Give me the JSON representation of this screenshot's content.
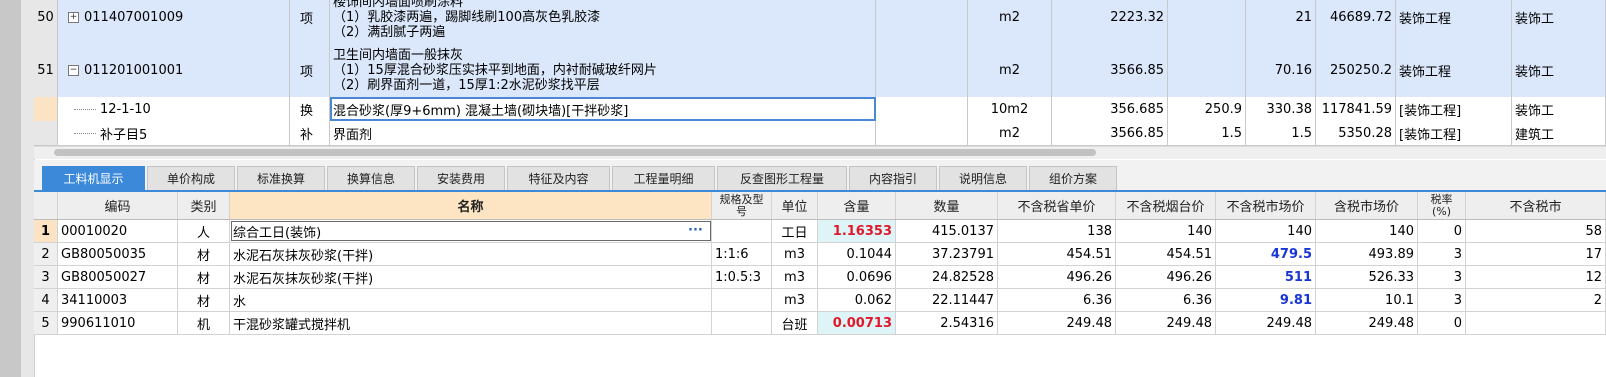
{
  "upper_rows": [
    {
      "num": "50",
      "code": "011407001009",
      "kind": "项",
      "desc": [
        "楼饰间内墙面喷刷涂料",
        "（1）乳胶漆两遍，踢脚线刷100高灰色乳胶漆",
        "（2）满刮腻子两遍"
      ],
      "unit": "m2",
      "qty": "2223.32",
      "price": "",
      "unitprice": "21",
      "total": "46689.72",
      "prof": "装饰工程",
      "prof2": "装饰工"
    },
    {
      "num": "51",
      "code": "011201001001",
      "kind": "项",
      "desc": [
        "卫生间内墙面一般抹灰",
        "（1）15厚混合砂浆压实抹平到地面，内衬耐碱玻纤网片",
        "（2）刷界面剂一道，15厚1:2水泥砂浆找平层"
      ],
      "unit": "m2",
      "qty": "3566.85",
      "price": "",
      "unitprice": "70.16",
      "total": "250250.2",
      "prof": "装饰工程",
      "prof2": "装饰工"
    },
    {
      "num": "",
      "code": "12-1-10",
      "kind": "换",
      "desc": [
        "混合砂浆(厚9+6mm) 混凝土墙(砌块墙)[干拌砂浆]"
      ],
      "unit": "10m2",
      "qty": "356.685",
      "price": "250.9",
      "unitprice": "330.38",
      "total": "117841.59",
      "prof": "[装饰工程]",
      "prof2": "装饰工"
    },
    {
      "num": "",
      "code": "补子目5",
      "kind": "补",
      "desc": [
        "界面剂"
      ],
      "unit": "m2",
      "qty": "3566.85",
      "price": "1.5",
      "unitprice": "1.5",
      "total": "5350.28",
      "prof": "[装饰工程]",
      "prof2": "建筑工"
    }
  ],
  "tabs": [
    "工料机显示",
    "单价构成",
    "标准换算",
    "换算信息",
    "安装费用",
    "特征及内容",
    "工程量明细",
    "反查图形工程量",
    "内容指引",
    "说明信息",
    "组价方案"
  ],
  "headers": {
    "code": "编码",
    "type": "类别",
    "name": "名称",
    "spec": "规格及型号",
    "unit": "单位",
    "content": "含量",
    "qty": "数量",
    "p1": "不含税省单价",
    "p2": "不含税烟台价",
    "p3": "不含税市场价",
    "p4": "含税市场价",
    "tax": "税率(%)",
    "p5": "不含税市"
  },
  "rows": [
    {
      "rn": "1",
      "code": "00010020",
      "type": "人",
      "name": "综合工日(装饰)",
      "spec": "",
      "unit": "工日",
      "content": "1.16353",
      "qty": "415.0137",
      "p1": "138",
      "p2": "140",
      "p3": "140",
      "p4": "140",
      "tax": "0",
      "p5": "58"
    },
    {
      "rn": "2",
      "code": "GB80050035",
      "type": "材",
      "name": "水泥石灰抹灰砂浆(干拌)",
      "spec": "1:1:6",
      "unit": "m3",
      "content": "0.1044",
      "qty": "37.23791",
      "p1": "454.51",
      "p2": "454.51",
      "p3": "479.5",
      "p4": "493.89",
      "tax": "3",
      "p5": "17"
    },
    {
      "rn": "3",
      "code": "GB80050027",
      "type": "材",
      "name": "水泥石灰抹灰砂浆(干拌)",
      "spec": "1:0.5:3",
      "unit": "m3",
      "content": "0.0696",
      "qty": "24.82528",
      "p1": "496.26",
      "p2": "496.26",
      "p3": "511",
      "p4": "526.33",
      "tax": "3",
      "p5": "12"
    },
    {
      "rn": "4",
      "code": "34110003",
      "type": "材",
      "name": "水",
      "spec": "",
      "unit": "m3",
      "content": "0.062",
      "qty": "22.11447",
      "p1": "6.36",
      "p2": "6.36",
      "p3": "9.81",
      "p4": "10.1",
      "tax": "3",
      "p5": "2"
    },
    {
      "rn": "5",
      "code": "990611010",
      "type": "机",
      "name": "干混砂浆罐式搅拌机",
      "spec": "",
      "unit": "台班",
      "content": "0.00713",
      "qty": "2.54316",
      "p1": "249.48",
      "p2": "249.48",
      "p3": "249.48",
      "p4": "249.48",
      "tax": "0",
      "p5": ""
    }
  ],
  "icons": {
    "expand": "plus-box-icon",
    "collapse": "minus-box-icon",
    "more": "ellipsis-icon"
  },
  "colors": {
    "row_highlight": "#dbe7fa",
    "tab_active": "#3d89d9",
    "name_header": "#fde5c4",
    "red": "#e0182b",
    "blue": "#1a35d6"
  }
}
